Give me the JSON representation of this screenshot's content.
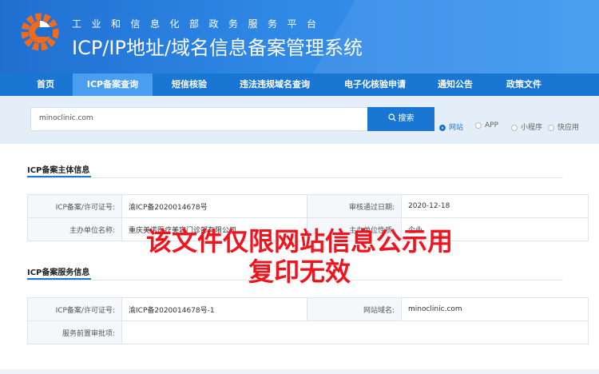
{
  "header": {
    "subtitle": "工业和信息化部政务服务平台",
    "title": "ICP/IP地址/域名信息备案管理系统"
  },
  "nav": {
    "items": [
      {
        "label": "首页"
      },
      {
        "label": "ICP备案查询"
      },
      {
        "label": "短信核验"
      },
      {
        "label": "违法违规域名查询"
      },
      {
        "label": "电子化核验申请"
      },
      {
        "label": "通知公告"
      },
      {
        "label": "政策文件"
      }
    ]
  },
  "search": {
    "value": "minoclinic.com",
    "button_label": "搜索",
    "options": [
      {
        "label": "网站",
        "checked": true
      },
      {
        "label": "APP",
        "checked": false
      },
      {
        "label": "小程序",
        "checked": false
      },
      {
        "label": "快应用",
        "checked": false
      }
    ]
  },
  "subject_section": {
    "title": "ICP备案主体信息",
    "license_label": "ICP备案/许可证号:",
    "license_value": "渝ICP备2020014678号",
    "approval_date_label": "审核通过日期:",
    "approval_date_value": "2020-12-18",
    "sponsor_label": "主办单位名称:",
    "sponsor_value": "重庆美诺医疗美容门诊部有限公司",
    "sponsor_type_label": "主办单位性质:",
    "sponsor_type_value": "企业"
  },
  "service_section": {
    "title": "ICP备案服务信息",
    "license_label": "ICP备案/许可证号:",
    "license_value": "渝ICP备2020014678号-1",
    "domain_label": "网站域名:",
    "domain_value": "minoclinic.com",
    "pre_approval_label": "服务前置审批项:",
    "pre_approval_value": ""
  },
  "watermark": {
    "line1": "该文件仅限网站信息公示用",
    "line2": "复印无效"
  },
  "colors": {
    "brand_blue": "#1976d2",
    "watermark_red": "#f0141e",
    "logo_orange": "#f06a20"
  }
}
